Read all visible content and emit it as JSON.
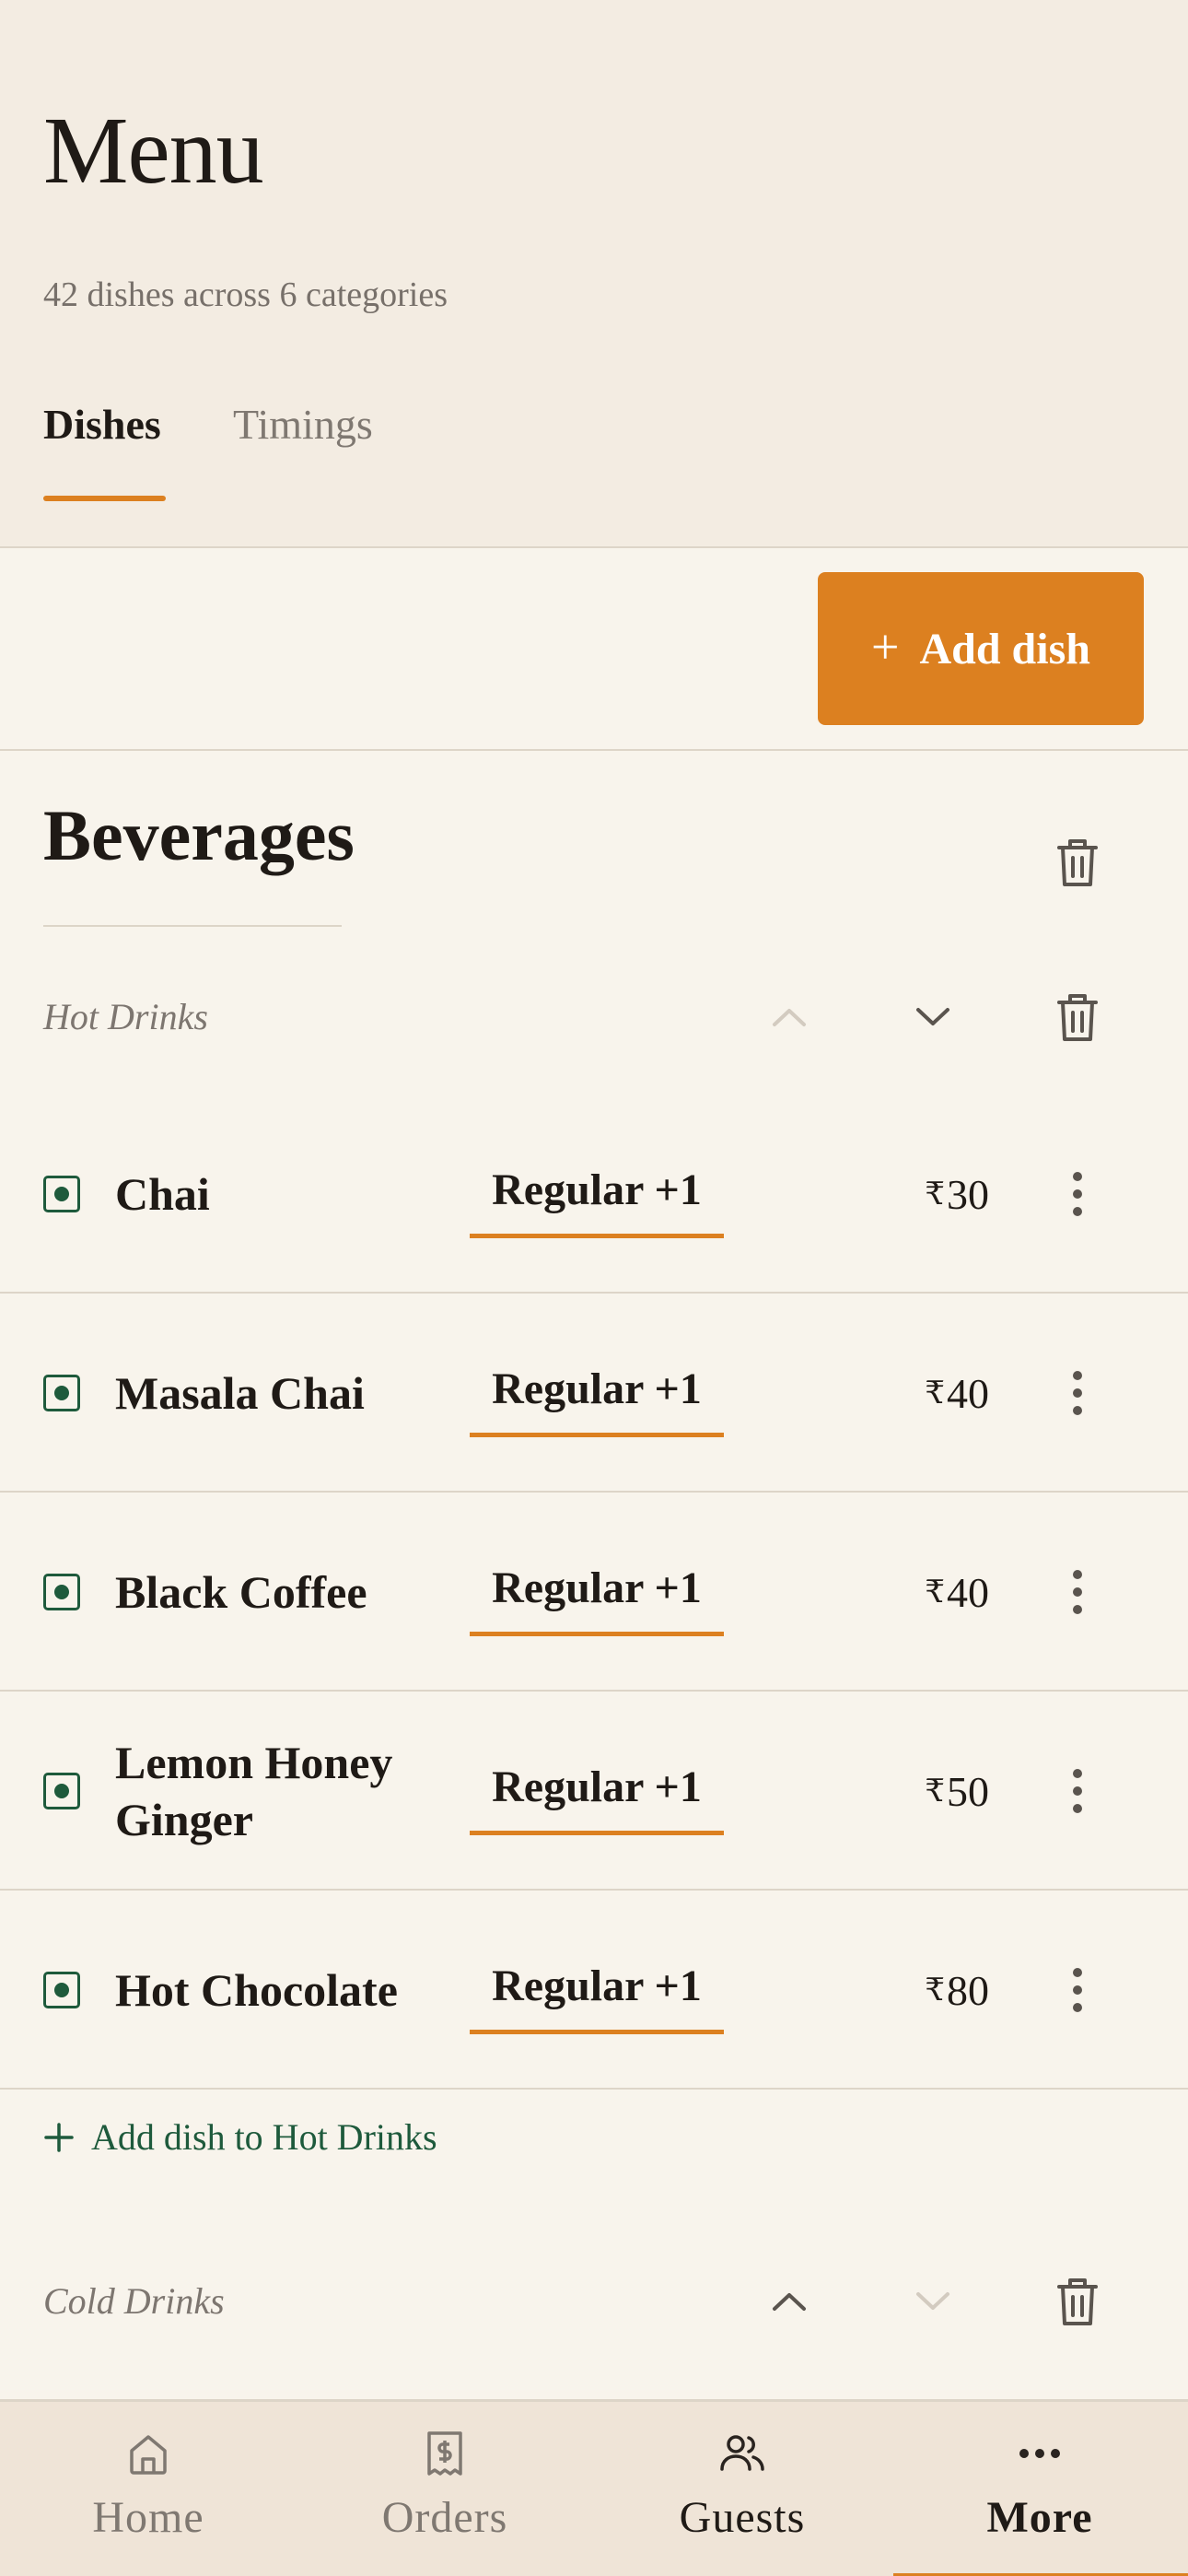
{
  "header": {
    "title": "Menu",
    "subtitle": "42 dishes across 6 categories",
    "tabs": [
      {
        "label": "Dishes",
        "active": true
      },
      {
        "label": "Timings",
        "active": false
      }
    ]
  },
  "toolbar": {
    "add_dish_icon": "plus-icon",
    "add_dish_label": "Add dish"
  },
  "category": {
    "title": "Beverages",
    "delete_icon": "trash-icon"
  },
  "subcategories": [
    {
      "label": "Hot Drinks",
      "move_up_enabled": false,
      "move_down_enabled": true,
      "dishes": [
        {
          "name": "Chai",
          "variant": "Regular +1",
          "currency": "₹",
          "price": "30",
          "veg": true
        },
        {
          "name": "Masala Chai",
          "variant": "Regular +1",
          "currency": "₹",
          "price": "40",
          "veg": true
        },
        {
          "name": "Black Coffee",
          "variant": "Regular +1",
          "currency": "₹",
          "price": "40",
          "veg": true
        },
        {
          "name": "Lemon Honey Ginger",
          "variant": "Regular +1",
          "currency": "₹",
          "price": "50",
          "veg": true
        },
        {
          "name": "Hot Chocolate",
          "variant": "Regular +1",
          "currency": "₹",
          "price": "80",
          "veg": true
        }
      ],
      "add_label": "Add dish to Hot Drinks"
    },
    {
      "label": "Cold Drinks",
      "move_up_enabled": true,
      "move_down_enabled": false
    }
  ],
  "bottom_nav": [
    {
      "label": "Home",
      "icon": "home-icon",
      "active": false
    },
    {
      "label": "Orders",
      "icon": "receipt-icon",
      "active": false
    },
    {
      "label": "Guests",
      "icon": "users-icon",
      "active": false
    },
    {
      "label": "More",
      "icon": "more-icon",
      "active": true
    }
  ],
  "colors": {
    "accent": "#dc8020",
    "veg_green": "#1e5a3c",
    "background": "#f8f4ec",
    "header_background": "#f3ece2"
  }
}
